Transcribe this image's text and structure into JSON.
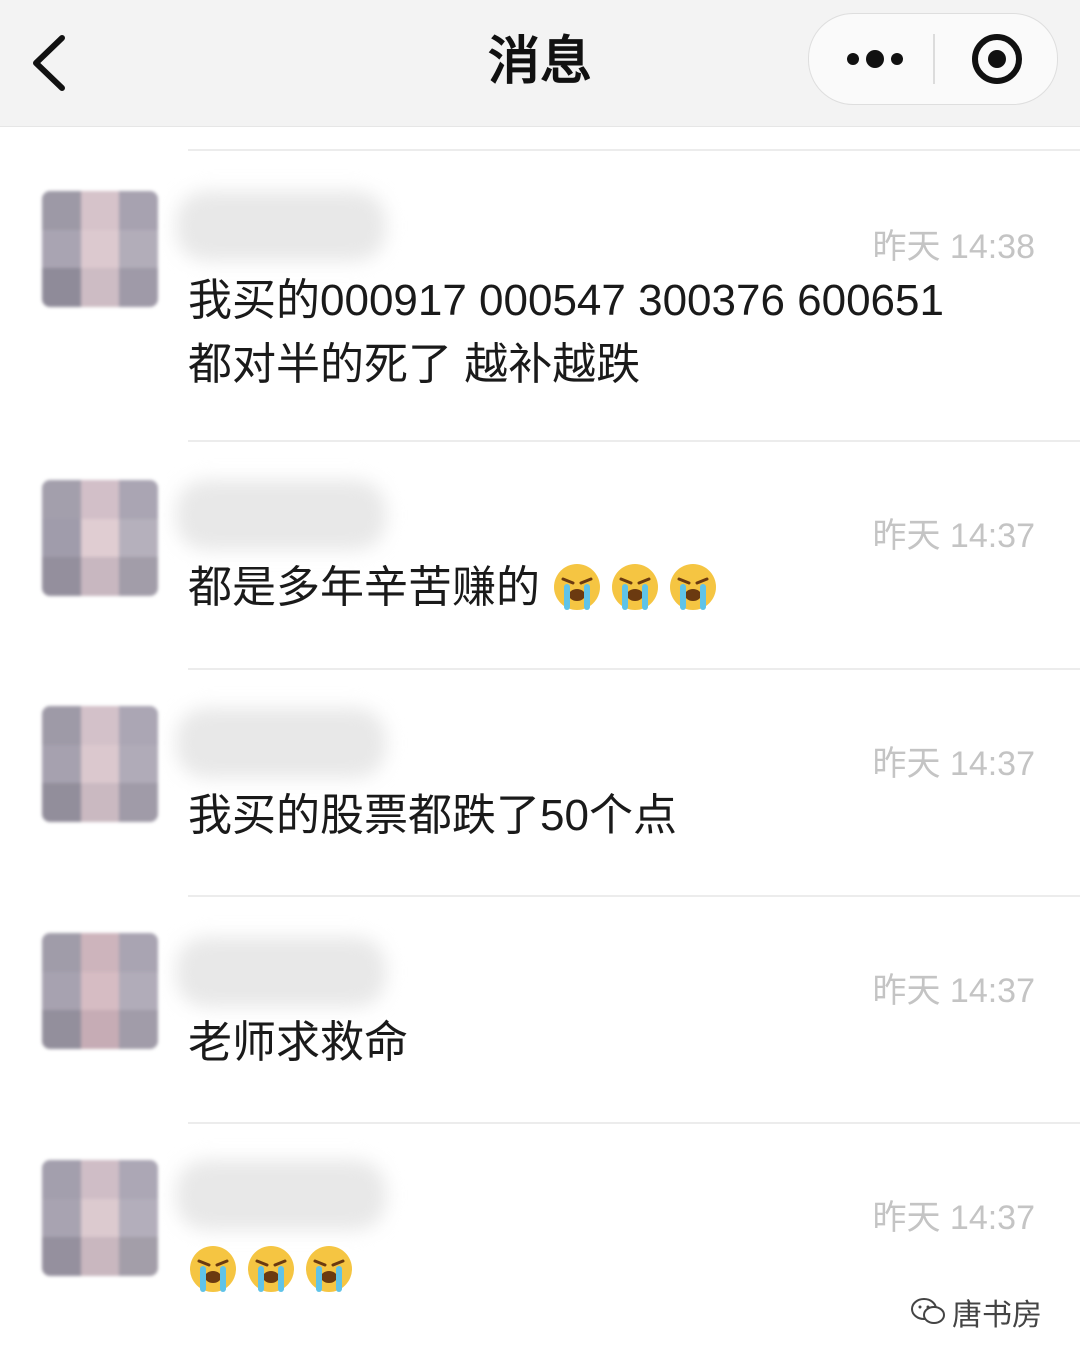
{
  "nav": {
    "title": "消息",
    "back_icon": "chevron-left-icon",
    "more_icon": "more-dots-icon",
    "close_icon": "target-circle-icon"
  },
  "messages": [
    {
      "time": "昨天 14:38",
      "text_line1": "我买的000917 000547 300376 600651",
      "text_line2": "都对半的死了 越补越跌"
    },
    {
      "time": "昨天 14:37",
      "text": "都是多年辛苦赚的",
      "emoji_count": 3,
      "emoji": "crying-face-icon"
    },
    {
      "time": "昨天 14:37",
      "text": "我买的股票都跌了50个点"
    },
    {
      "time": "昨天 14:37",
      "text": "老师求救命"
    },
    {
      "time": "昨天 14:37",
      "text": "",
      "emoji_count": 3,
      "emoji": "crying-face-icon"
    }
  ],
  "watermark": {
    "text": "唐书房",
    "icon": "wechat-icon"
  },
  "colors": {
    "nav_bg": "#f3f3f3",
    "time": "#c4c4c4",
    "text": "#1a1a1a",
    "emoji": "#f5c542"
  }
}
